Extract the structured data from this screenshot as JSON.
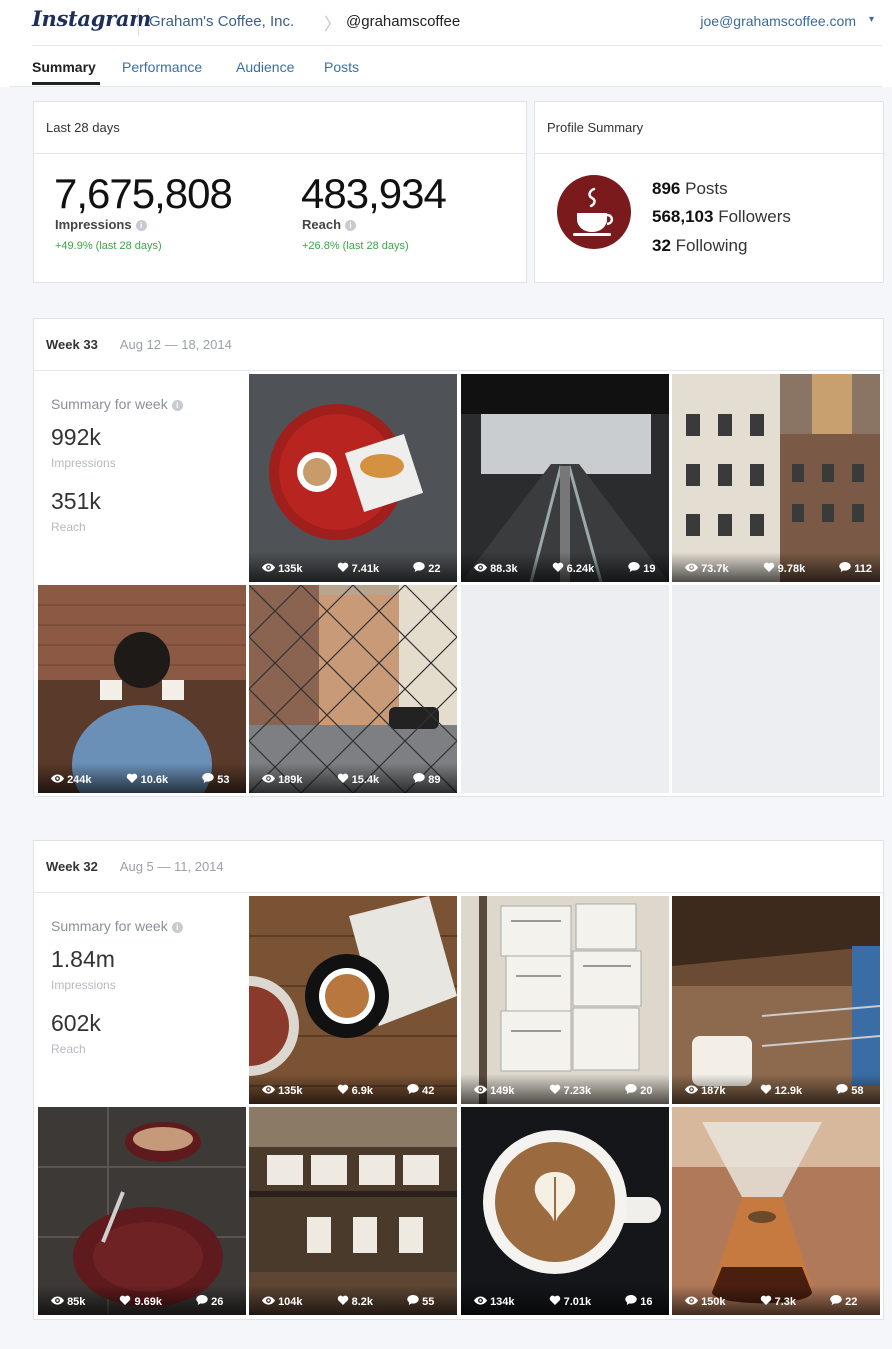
{
  "header": {
    "logo": "Instagram",
    "company": "Graham's Coffee, Inc.",
    "chevron": "〉",
    "handle": "@grahamscoffee",
    "user_email": "joe@grahamscoffee.com",
    "user_caret": "▾"
  },
  "tabs": [
    {
      "label": "Summary",
      "active": true
    },
    {
      "label": "Performance",
      "active": false
    },
    {
      "label": "Audience",
      "active": false
    },
    {
      "label": "Posts",
      "active": false
    }
  ],
  "overview": {
    "title": "Last 28 days",
    "impressions": {
      "value": "7,675,808",
      "label": "Impressions",
      "change": "+49.9% (last 28 days)"
    },
    "reach": {
      "value": "483,934",
      "label": "Reach",
      "change": "+26.8% (last 28 days)"
    }
  },
  "profile": {
    "title": "Profile Summary",
    "posts_count": "896",
    "posts_label": "Posts",
    "followers_count": "568,103",
    "followers_label": "Followers",
    "following_count": "32",
    "following_label": "Following"
  },
  "weeks": [
    {
      "title": "Week 33",
      "dates": "Aug 12 — 18, 2014",
      "summary_title": "Summary for week",
      "impressions": "992k",
      "impressions_label": "Impressions",
      "reach": "351k",
      "reach_label": "Reach",
      "posts": [
        {
          "views": "135k",
          "likes": "7.41k",
          "comments": "22"
        },
        {
          "views": "88.3k",
          "likes": "6.24k",
          "comments": "19"
        },
        {
          "views": "73.7k",
          "likes": "9.78k",
          "comments": "112"
        },
        {
          "views": "244k",
          "likes": "10.6k",
          "comments": "53"
        },
        {
          "views": "189k",
          "likes": "15.4k",
          "comments": "89"
        }
      ]
    },
    {
      "title": "Week 32",
      "dates": "Aug 5 — 11, 2014",
      "summary_title": "Summary for week",
      "impressions": "1.84m",
      "impressions_label": "Impressions",
      "reach": "602k",
      "reach_label": "Reach",
      "posts": [
        {
          "views": "135k",
          "likes": "6.9k",
          "comments": "42"
        },
        {
          "views": "149k",
          "likes": "7.23k",
          "comments": "20"
        },
        {
          "views": "187k",
          "likes": "12.9k",
          "comments": "58"
        },
        {
          "views": "85k",
          "likes": "9.69k",
          "comments": "26"
        },
        {
          "views": "104k",
          "likes": "8.2k",
          "comments": "55"
        },
        {
          "views": "134k",
          "likes": "7.01k",
          "comments": "16"
        },
        {
          "views": "150k",
          "likes": "7.3k",
          "comments": "22"
        }
      ]
    }
  ],
  "icons": {
    "info": "i",
    "views": "eye-icon",
    "likes": "heart-icon",
    "comments": "comment-icon"
  }
}
